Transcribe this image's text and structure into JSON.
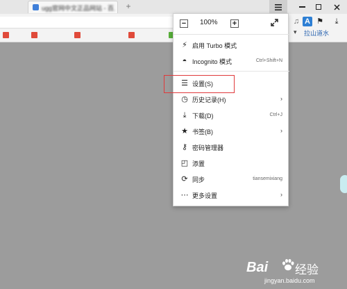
{
  "browser": {
    "tab_title": "ugg官网中文正品网站 - 百度搜索",
    "new_tab_glyph": "+",
    "menu_icon": "hamburger-icon",
    "window_controls": [
      "minimize",
      "maximize",
      "close"
    ],
    "toolbar_right": {
      "translate_glyph": "A",
      "flag_icon": "flag-icon",
      "download_icon": "download-icon"
    },
    "bookmark_bar": {
      "dropdown_text": "▾",
      "link_text": "拉山道水",
      "link_text2": "拉",
      "chevron": "»"
    }
  },
  "menu": {
    "zoom": {
      "value": "100%",
      "minus": "−",
      "plus": "+"
    },
    "items": [
      {
        "label": "启用 Turbo 模式",
        "icon": "rocket-icon",
        "glyph": "⚡",
        "shortcut": ""
      },
      {
        "label": "Incognito 模式",
        "icon": "mask-icon",
        "glyph": "◓",
        "shortcut": "Ctrl+Shift+N"
      },
      {
        "label": "设置(S)",
        "icon": "settings-sliders-icon",
        "glyph": "☰",
        "shortcut": ""
      },
      {
        "label": "历史记录(H)",
        "icon": "clock-icon",
        "glyph": "◷",
        "shortcut": "",
        "submenu": true
      },
      {
        "label": "下载(D)",
        "icon": "download-icon",
        "glyph": "⤓",
        "shortcut": "Ctrl+J"
      },
      {
        "label": "书签(B)",
        "icon": "bookmark-icon",
        "glyph": "★",
        "shortcut": "",
        "submenu": true
      },
      {
        "label": "密码管理器",
        "icon": "key-icon",
        "glyph": "⚷",
        "shortcut": ""
      },
      {
        "label": "添置",
        "icon": "extension-icon",
        "glyph": "◰",
        "shortcut": ""
      },
      {
        "label": "同步",
        "icon": "sync-icon",
        "glyph": "⟳",
        "shortcut": "tiansemixiang"
      },
      {
        "label": "更多设置",
        "icon": "more-icon",
        "glyph": "⋯",
        "shortcut": "",
        "submenu": true
      }
    ],
    "arrow_glyph": "›"
  },
  "watermark": {
    "logo": "Bai",
    "logo_suffix": "经验",
    "url": "jingyan.baidu.com"
  },
  "colors": {
    "highlight_border": "#e0393b",
    "page_background": "#9c9c9c",
    "menu_background": "#ffffff"
  }
}
